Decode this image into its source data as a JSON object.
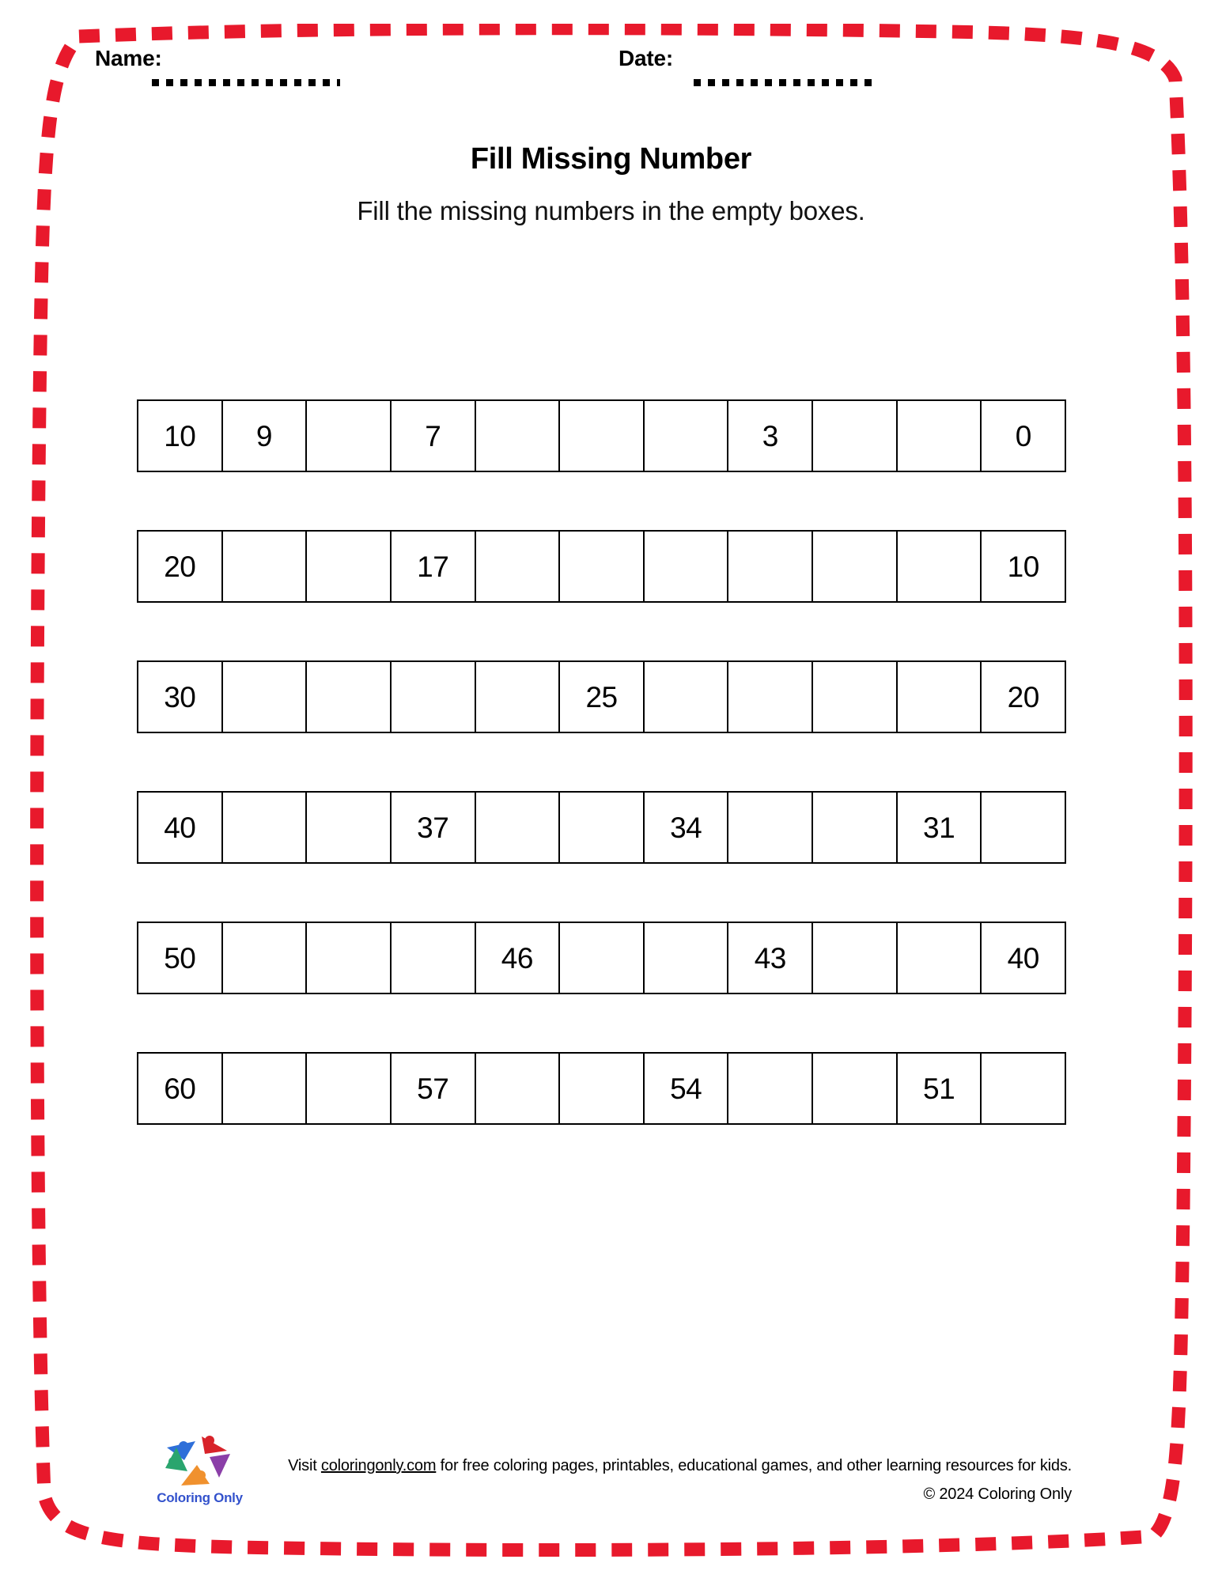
{
  "worksheet": {
    "name_label": "Name:",
    "date_label": "Date:",
    "title": "Fill Missing Number",
    "subtitle": "Fill the missing numbers in the empty boxes.",
    "border_color": "#E8192C",
    "rows": [
      {
        "cells": [
          "10",
          "9",
          "",
          "7",
          "",
          "",
          "",
          "3",
          "",
          "",
          "0"
        ]
      },
      {
        "cells": [
          "20",
          "",
          "",
          "17",
          "",
          "",
          "",
          "",
          "",
          "",
          "10"
        ]
      },
      {
        "cells": [
          "30",
          "",
          "",
          "",
          "",
          "25",
          "",
          "",
          "",
          "",
          "20"
        ]
      },
      {
        "cells": [
          "40",
          "",
          "",
          "37",
          "",
          "",
          "34",
          "",
          "",
          "31",
          ""
        ]
      },
      {
        "cells": [
          "50",
          "",
          "",
          "",
          "46",
          "",
          "",
          "43",
          "",
          "",
          "40"
        ]
      },
      {
        "cells": [
          "60",
          "",
          "",
          "57",
          "",
          "",
          "54",
          "",
          "",
          "51",
          ""
        ]
      }
    ]
  },
  "footer": {
    "logo_text": "Coloring Only",
    "logo_text_color": "#3352CC",
    "visit_prefix": "Visit ",
    "visit_link": "coloringonly.com",
    "visit_suffix": " for free coloring pages, printables, educational games, and other learning resources for kids.",
    "copyright": "© 2024 Coloring Only"
  }
}
